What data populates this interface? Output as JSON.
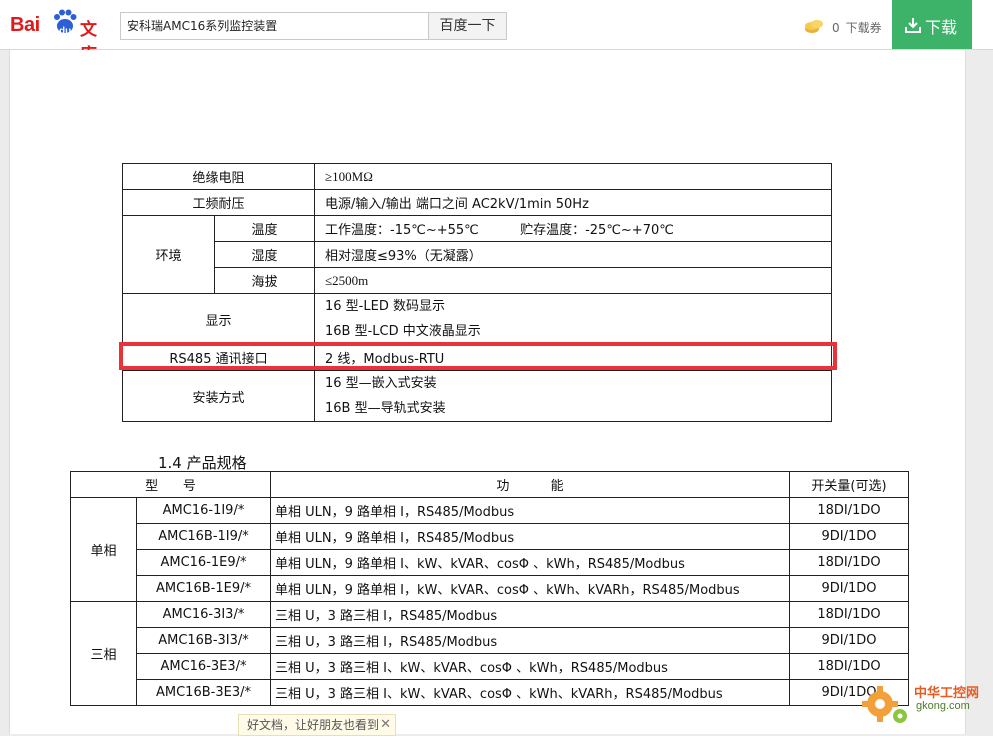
{
  "header": {
    "logo_text_bai": "Bai",
    "logo_text_du": "du",
    "logo_text_wenku": "文库",
    "search_value": "安科瑞AMC16系列监控装置",
    "search_button": "百度一下",
    "voucher_count": "0",
    "voucher_label": "下载券",
    "download_button": "下载",
    "brand_color": "#e01a1a",
    "download_color": "#3db36a"
  },
  "spec_table": {
    "rows": [
      {
        "label": "绝缘电阻",
        "value": "≥100MΩ"
      },
      {
        "label": "工频耐压",
        "value": "电源/输入/输出 端口之间 AC2kV/1min 50Hz"
      }
    ],
    "env_label": "环境",
    "env_rows": [
      {
        "label": "温度",
        "value": "工作温度：-15℃~+55℃          贮存温度：-25℃~+70℃"
      },
      {
        "label": "湿度",
        "value": "相对湿度≤93%（无凝露）"
      },
      {
        "label": "海拔",
        "value": "≤2500m"
      }
    ],
    "display_label": "显示",
    "display_values": [
      "16 型-LED 数码显示",
      "16B 型-LCD 中文液晶显示"
    ],
    "rs485_label": "RS485 通讯接口",
    "rs485_value": "2 线，Modbus-RTU",
    "install_label": "安装方式",
    "install_values": [
      "16 型—嵌入式安装",
      "16B 型—导轨式安装"
    ],
    "highlight_color": "#e8333a"
  },
  "section_title": "1.4 产品规格",
  "product_table": {
    "headers": {
      "model": "型      号",
      "function": "功          能",
      "switch": "开关量(可选)"
    },
    "groups": [
      {
        "name": "单相",
        "rows": [
          {
            "model": "AMC16-1I9/*",
            "function": "单相 ULN，9 路单相 I，RS485/Modbus",
            "switch": "18DI/1DO"
          },
          {
            "model": "AMC16B-1I9/*",
            "function": "单相 ULN，9 路单相 I，RS485/Modbus",
            "switch": "9DI/1DO"
          },
          {
            "model": "AMC16-1E9/*",
            "function": "单相 ULN，9 路单相 I、kW、kVAR、cosΦ 、kWh，RS485/Modbus",
            "switch": "18DI/1DO"
          },
          {
            "model": "AMC16B-1E9/*",
            "function": "单相 ULN，9 路单相 I，kW、kVAR、cosΦ 、kWh、kVARh，RS485/Modbus",
            "switch": "9DI/1DO"
          }
        ]
      },
      {
        "name": "三相",
        "rows": [
          {
            "model": "AMC16-3I3/*",
            "function": "三相 U，3 路三相 I，RS485/Modbus",
            "switch": "18DI/1DO"
          },
          {
            "model": "AMC16B-3I3/*",
            "function": "三相 U，3 路三相 I，RS485/Modbus",
            "switch": "9DI/1DO"
          },
          {
            "model": "AMC16-3E3/*",
            "function": "三相 U，3 路三相 I、kW、kVAR、cosΦ 、kWh，RS485/Modbus",
            "switch": "18DI/1DO"
          },
          {
            "model": "AMC16B-3E3/*",
            "function": "三相 U，3 路三相 I、kW、kVAR、cosΦ 、kWh、kVARh，RS485/Modbus",
            "switch": "9DI/1DO"
          }
        ]
      }
    ]
  },
  "share_tip": "好文档，让好朋友也看到",
  "share_close": "✕",
  "watermark": {
    "line1": "中华工控网",
    "line2": "gkong.com"
  }
}
